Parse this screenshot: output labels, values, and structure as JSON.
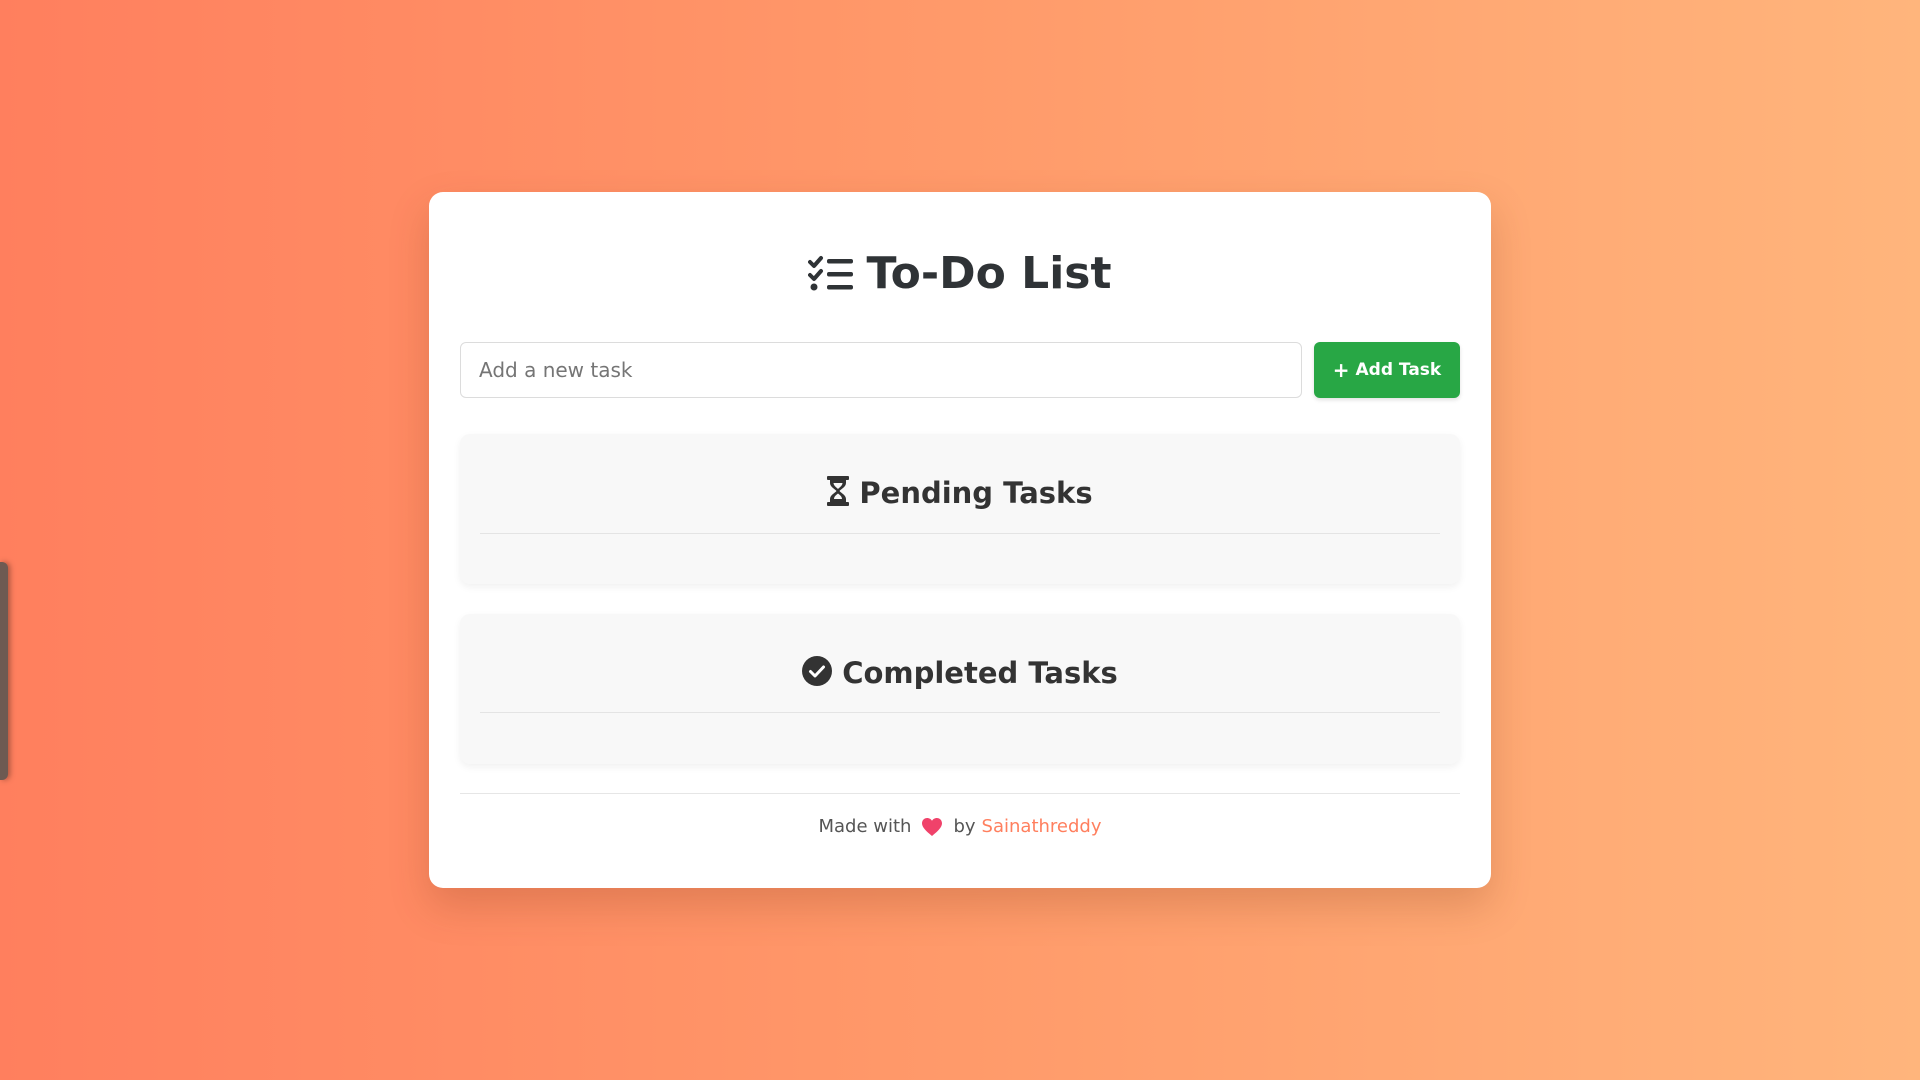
{
  "app": {
    "title": "To-Do List"
  },
  "input": {
    "placeholder": "Add a new task",
    "value": ""
  },
  "add_button": {
    "label": "Add Task",
    "color": "#28a745"
  },
  "sections": {
    "pending": {
      "title": "Pending Tasks",
      "icon": "hourglass-icon",
      "tasks": []
    },
    "completed": {
      "title": "Completed Tasks",
      "icon": "check-circle-icon",
      "tasks": []
    }
  },
  "footer": {
    "made_with": "Made with",
    "by": "by",
    "author": "Sainathreddy",
    "heart_icon": "heart-icon"
  },
  "colors": {
    "background_start": "#ff7f5e",
    "background_end": "#ffb57c",
    "accent": "#ff7f5e",
    "heart": "#f0426a"
  }
}
